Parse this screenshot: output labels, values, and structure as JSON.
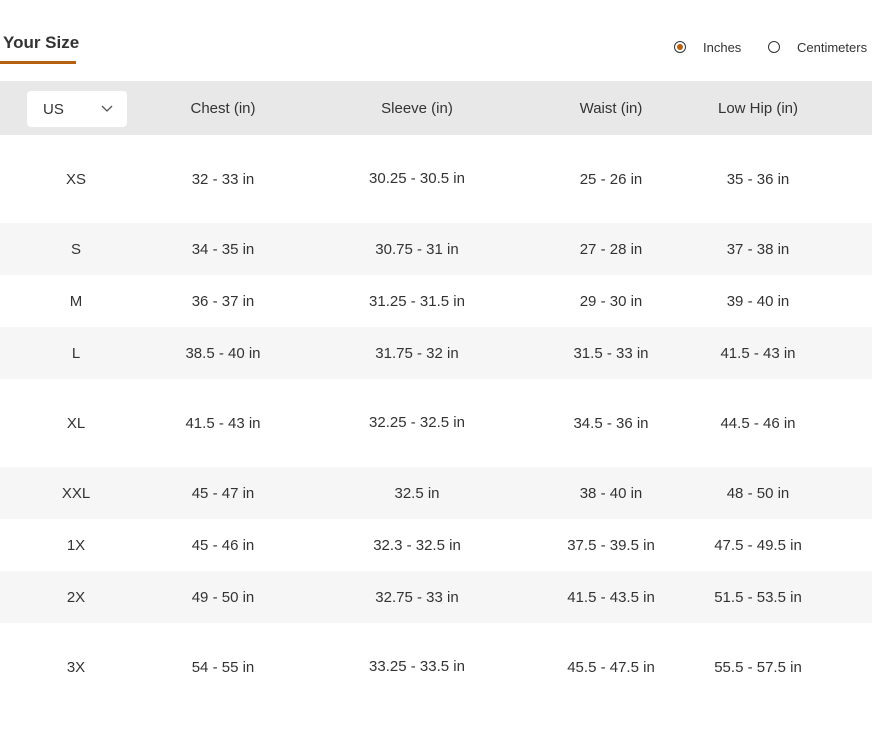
{
  "tab": {
    "label": "Your Size"
  },
  "units": {
    "options": [
      {
        "label": "Inches",
        "selected": true
      },
      {
        "label": "Centimeters",
        "selected": false
      }
    ]
  },
  "region_select": {
    "value": "US"
  },
  "columns": [
    "Chest (in)",
    "Sleeve (in)",
    "Waist (in)",
    "Low Hip (in)"
  ],
  "rows": [
    {
      "size": "XS",
      "chest": "32 - 33 in",
      "sleeve": "30.25 - 30.5 in",
      "waist": "25 - 26 in",
      "hip": "35 - 36 in"
    },
    {
      "size": "S",
      "chest": "34 - 35 in",
      "sleeve": "30.75 - 31 in",
      "waist": "27 - 28 in",
      "hip": "37 - 38 in"
    },
    {
      "size": "M",
      "chest": "36 - 37 in",
      "sleeve": "31.25 - 31.5 in",
      "waist": "29 - 30 in",
      "hip": "39 - 40 in"
    },
    {
      "size": "L",
      "chest": "38.5 - 40 in",
      "sleeve": "31.75 - 32 in",
      "waist": "31.5 - 33 in",
      "hip": "41.5 - 43 in"
    },
    {
      "size": "XL",
      "chest": "41.5 - 43 in",
      "sleeve": "32.25 - 32.5 in",
      "waist": "34.5 - 36 in",
      "hip": "44.5 - 46 in"
    },
    {
      "size": "XXL",
      "chest": "45 - 47 in",
      "sleeve": "32.5 in",
      "waist": "38 - 40 in",
      "hip": "48 - 50 in"
    },
    {
      "size": "1X",
      "chest": "45 - 46 in",
      "sleeve": "32.3 - 32.5 in",
      "waist": "37.5 - 39.5 in",
      "hip": "47.5 - 49.5 in"
    },
    {
      "size": "2X",
      "chest": "49 - 50 in",
      "sleeve": "32.75 - 33 in",
      "waist": "41.5 - 43.5 in",
      "hip": "51.5 - 53.5 in"
    },
    {
      "size": "3X",
      "chest": "54 - 55 in",
      "sleeve": "33.25 - 33.5 in",
      "waist": "45.5 - 47.5 in",
      "hip": "55.5 - 57.5 in"
    }
  ],
  "colors": {
    "accent": "#b4600e",
    "header_bg": "#e8e8e8",
    "alt_row_bg": "#f6f6f6"
  }
}
